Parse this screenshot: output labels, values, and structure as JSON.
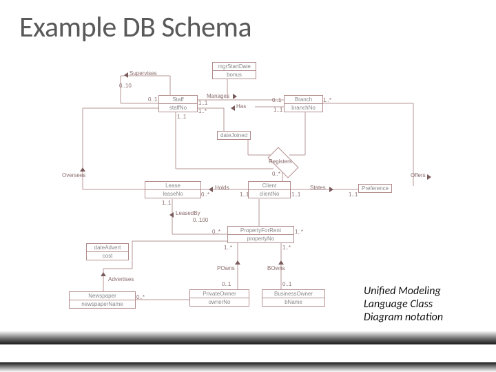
{
  "title": "Example DB Schema",
  "caption": "Unified Modeling Language Class Diagram notation",
  "entities": {
    "mgr": {
      "hdr": "mgrStartDate",
      "attr": "bonus"
    },
    "staff": {
      "hdr": "Staff",
      "attr": "staffNo"
    },
    "branch": {
      "hdr": "Branch",
      "attr": "branchNo"
    },
    "datejoined": {
      "hdr": "dateJoined"
    },
    "lease": {
      "hdr": "Lease",
      "attr": "leaseNo"
    },
    "client": {
      "hdr": "Client",
      "attr": "clientNo"
    },
    "preference": {
      "hdr": "Preference"
    },
    "property": {
      "hdr": "PropertyForRent",
      "attr": "propertyNo"
    },
    "dateadvert": {
      "hdr": "dateAdvert",
      "attr": "cost"
    },
    "newspaper": {
      "hdr": "Newspaper",
      "attr": "newspaperName"
    },
    "powner": {
      "hdr": "PrivateOwner",
      "attr": "ownerNo"
    },
    "bowner": {
      "hdr": "BusinessOwner",
      "attr": "bName"
    }
  },
  "labels": {
    "supervises": "Supervises",
    "manages": "Manages",
    "has": "Has",
    "registers": "Registers",
    "oversees": "Oversees",
    "holds": "Holds",
    "states": "States",
    "offers": "Offers",
    "leasedby": "LeasedBy",
    "advertises": "Advertises",
    "powns": "POwns",
    "bowns": "BOwns"
  },
  "card": {
    "c010": "0..10",
    "c01": "0..1",
    "c11": "1..1",
    "c0s": "0..*",
    "c1s": "1..*",
    "c0100": "0..100"
  }
}
